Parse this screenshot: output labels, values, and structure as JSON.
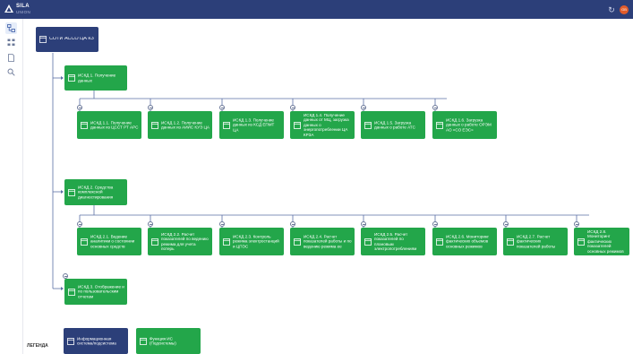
{
  "header": {
    "logo_line1": "SILA",
    "logo_line2": "UNION",
    "avatar_initials": "GB"
  },
  "colors": {
    "header": "#2c3f79",
    "node_green": "#23a64a",
    "node_navy": "#2c3f79",
    "connector": "#5a6fa5",
    "avatar": "#e25c2b"
  },
  "sidebar": {
    "items": [
      {
        "icon": "diagram-icon",
        "active": true
      },
      {
        "icon": "hierarchy-icon",
        "active": false
      },
      {
        "icon": "document-icon",
        "active": false
      },
      {
        "icon": "search-icon",
        "active": false
      }
    ]
  },
  "diagram": {
    "root": {
      "label": "СОТИ АССО ЦА КЗ"
    },
    "level1": [
      {
        "label": "ИСКД 1. Получение данных"
      },
      {
        "label": "ИСКД 2. Средства комплексной диагностирования"
      },
      {
        "label": "ИСКД 3. Отображение и по пользовательским отчетам"
      }
    ],
    "group1": [
      {
        "label": "ИСКД 1.1. Получение данных из ЦССТ РТ АРС"
      },
      {
        "label": "ИСКД 1.2. Получение данных из АИИС КУЭ ЦА"
      },
      {
        "label": "ИСКД 1.3. Получение данных из КСД ЕПМТ ЦА"
      },
      {
        "label": "ИСКД 1.4. Получение данных от МЦ, загрузка данных о энергопотреблении ЦА КРЗА"
      },
      {
        "label": "ИСКД 1.5. Загрузка данных о работе АТС"
      },
      {
        "label": "ИСКД 1.6. Загрузка данных о работе ОРЭМ АО «СО ЕЭС»"
      }
    ],
    "group2": [
      {
        "label": "ИСКД 2.1. Ведение аналитики о состоянии основных средств"
      },
      {
        "label": "ИСКД 2.2. Расчет показателей по ведению режима для учета потерь"
      },
      {
        "label": "ИСКД 2.3. Контроль режима электростанций и ЦПЭС"
      },
      {
        "label": "ИСКД 2.4. Расчет показателей работы и по ведению режима ee"
      },
      {
        "label": "ИСКД 2.5. Расчет показателей по плановым электропотреблениям"
      },
      {
        "label": "ИСКД 2.6. Мониторинг фактических объемов основных режимов"
      },
      {
        "label": "ИСКД 2.7. Расчет фактических показателей работы"
      },
      {
        "label": "ИСКД 2.8. Мониторинг фактических показателей основных режимов"
      }
    ]
  },
  "legend": {
    "title": "ЛЕГЕНДА",
    "items": [
      {
        "label": "Информационная система/подсистема",
        "color": "#2c3f79"
      },
      {
        "label": "Функция ИС (Подсистемы)",
        "color": "#23a64a"
      }
    ]
  }
}
